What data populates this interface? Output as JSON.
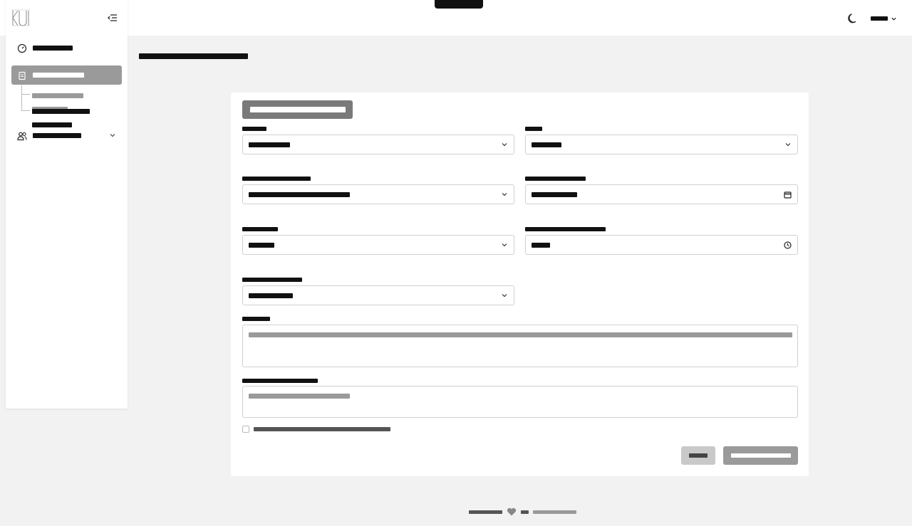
{
  "header": {
    "center_title": "",
    "theme_icon": "moon-icon",
    "language_label": "",
    "language_icon": "chevron-down-icon"
  },
  "sidebar": {
    "logo_text": "KU",
    "collapse_icon": "menu-collapse-icon",
    "items": [
      {
        "label": "",
        "icon": "dashboard-icon",
        "active": false
      },
      {
        "label": "",
        "icon": "clipboard-icon",
        "active": true
      },
      {
        "label": "",
        "icon": "users-icon",
        "active": false,
        "has_children": true
      }
    ],
    "sub_items": [
      {
        "label": "",
        "active": false
      },
      {
        "label": "",
        "active": true
      }
    ]
  },
  "page": {
    "title": ""
  },
  "form": {
    "card_title": "",
    "fields": [
      {
        "label": "",
        "value": "",
        "type": "select"
      },
      {
        "label": "",
        "value": "",
        "type": "select"
      },
      {
        "label": "",
        "value": "",
        "type": "select"
      },
      {
        "label": "",
        "value": "",
        "type": "date"
      },
      {
        "label": "",
        "value": "",
        "type": "select"
      },
      {
        "label": "",
        "value": "",
        "type": "time"
      },
      {
        "label": "",
        "value": "",
        "type": "select"
      }
    ],
    "description_label": "",
    "description_placeholder": "",
    "notes_label": "",
    "notes_placeholder": "",
    "checkbox_label": "",
    "cancel_label": "",
    "submit_label": ""
  },
  "footer": {
    "left_text": "",
    "middle_text": "",
    "right_text": "",
    "heart_icon": "heart-icon"
  },
  "colors": {
    "active_nav": "#9a9a9a",
    "card_header": "#7a7a7a",
    "background": "#f2f2f2"
  }
}
